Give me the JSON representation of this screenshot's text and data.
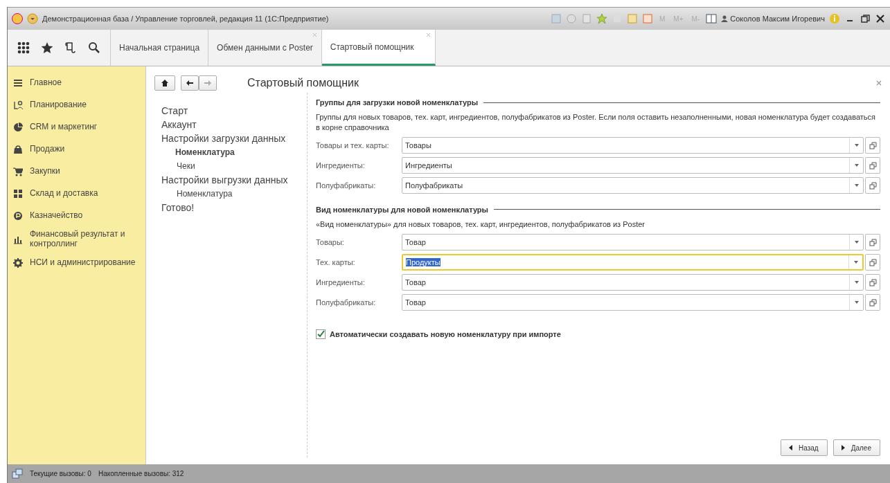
{
  "window": {
    "title": "Демонстрационная база / Управление торговлей, редакция 11  (1С:Предприятие)",
    "memory_buttons": [
      "M",
      "M+",
      "M-"
    ],
    "user": "Соколов Максим Игоревич"
  },
  "tabs": [
    {
      "label": "Начальная страница",
      "closable": false,
      "selected": false
    },
    {
      "label": "Обмен данными с Poster",
      "closable": true,
      "selected": false
    },
    {
      "label": "Стартовый помощник",
      "closable": true,
      "selected": true
    }
  ],
  "sidebar": {
    "items": [
      {
        "label": "Главное"
      },
      {
        "label": "Планирование"
      },
      {
        "label": "CRM и маркетинг"
      },
      {
        "label": "Продажи"
      },
      {
        "label": "Закупки"
      },
      {
        "label": "Склад и доставка"
      },
      {
        "label": "Казначейство"
      },
      {
        "label": "Финансовый результат и контроллинг"
      },
      {
        "label": "НСИ и администрирование"
      }
    ]
  },
  "form": {
    "title": "Стартовый помощник",
    "steps": [
      {
        "label": "Старт",
        "selected": false
      },
      {
        "label": "Аккаунт",
        "selected": false
      },
      {
        "label": "Настройки загрузки данных",
        "selected": false,
        "children": [
          {
            "label": "Номенклатура",
            "selected": true
          },
          {
            "label": "Чеки",
            "selected": false
          }
        ]
      },
      {
        "label": "Настройки выгрузки данных",
        "selected": false,
        "children": [
          {
            "label": "Номенклатура",
            "selected": false
          }
        ]
      },
      {
        "label": "Готово!",
        "selected": false
      }
    ],
    "sections": [
      {
        "title": "Группы для загрузки новой номенклатуры",
        "description": "Группы для новых товаров, тех. карт, ингредиентов, полуфабрикатов из Poster. Если поля оставить незаполненными, новая номенклатура будет создаваться в корне справочника",
        "fields": [
          {
            "label": "Товары и тех. карты:",
            "value": "Товары",
            "focused": false
          },
          {
            "label": "Ингредиенты:",
            "value": "Ингредиенты",
            "focused": false
          },
          {
            "label": "Полуфабрикаты:",
            "value": "Полуфабрикаты",
            "focused": false
          }
        ]
      },
      {
        "title": "Вид номенклатуры для новой номенклатуры",
        "description": "«Вид номенклатуры» для новых товаров, тех. карт, ингредиентов, полуфабрикатов из Poster",
        "fields": [
          {
            "label": "Товары:",
            "value": "Товар",
            "focused": false
          },
          {
            "label": "Тех. карты:",
            "value": "Продукты",
            "focused": true
          },
          {
            "label": "Ингредиенты:",
            "value": "Товар",
            "focused": false
          },
          {
            "label": "Полуфабрикаты:",
            "value": "Товар",
            "focused": false
          }
        ]
      }
    ],
    "checkbox": {
      "label": "Автоматически создавать новую номенклатуру при импорте",
      "checked": true
    },
    "buttons": [
      {
        "label": "Назад",
        "kind": "back"
      },
      {
        "label": "Далее",
        "kind": "next"
      }
    ]
  },
  "status_bar": {
    "items": [
      "Текущие вызовы: 0",
      "Накопленные вызовы: 312"
    ]
  }
}
